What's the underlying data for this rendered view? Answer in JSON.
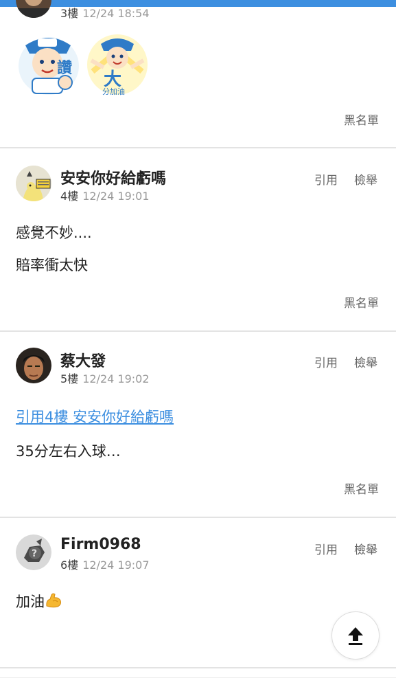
{
  "app": {
    "accent_color": "#3d8fe0"
  },
  "posts": [
    {
      "floor": "3樓",
      "time": "12/24 18:54",
      "stickers": [
        "讚 sticker",
        "大分加油 sticker"
      ],
      "blacklist_label": "黑名單"
    },
    {
      "author": "安安你好給虧嗎",
      "floor": "4樓",
      "time": "12/24 19:01",
      "quote_label": "引用",
      "report_label": "檢舉",
      "lines": [
        "感覺不妙....",
        "賠率衝太快"
      ],
      "blacklist_label": "黑名單"
    },
    {
      "author": "蔡大發",
      "floor": "5樓",
      "time": "12/24 19:02",
      "quote_label": "引用",
      "report_label": "檢舉",
      "quote_link": "引用4樓 安安你好給虧嗎",
      "lines": [
        "35分左右入球…"
      ],
      "blacklist_label": "黑名單"
    },
    {
      "author": "Firm0968",
      "floor": "6樓",
      "time": "12/24 19:07",
      "quote_label": "引用",
      "report_label": "檢舉",
      "lines": [
        "加油"
      ],
      "emoji": "flexed-biceps-icon"
    }
  ],
  "scroll_top": {
    "icon": "arrow-up-icon"
  }
}
